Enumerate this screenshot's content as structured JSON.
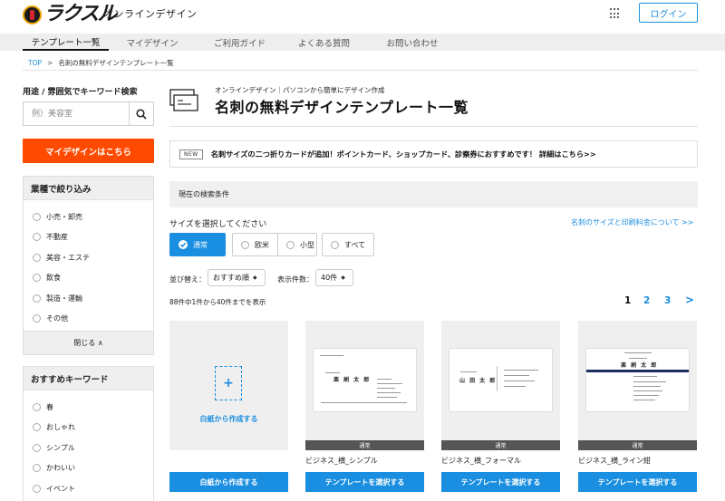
{
  "header": {
    "logo_text": "ラクスル",
    "site_title": "オンラインデザイン",
    "login_label": "ログイン"
  },
  "nav": [
    {
      "label": "テンプレート一覧",
      "active": true
    },
    {
      "label": "マイデザイン"
    },
    {
      "label": "ご利用ガイド"
    },
    {
      "label": "よくある質問"
    },
    {
      "label": "お問い合わせ"
    }
  ],
  "breadcrumb": {
    "home": "TOP",
    "separator": ">",
    "current": "名刺の無料デザインテンプレート一覧"
  },
  "sidebar": {
    "keyword_label": "用途 / 雰囲気でキーワード検索",
    "search_placeholder": "例）美容室",
    "mydesign_button": "マイデザインはこちら",
    "industry": {
      "title": "業種で絞り込み",
      "items": [
        "小売・卸売",
        "不動産",
        "美容・エステ",
        "飲食",
        "製造・運輸",
        "その他"
      ],
      "close_label": "閉じる ∧"
    },
    "keywords": {
      "title": "おすすめキーワード",
      "items": [
        "春",
        "おしゃれ",
        "シンプル",
        "かわいい",
        "イベント"
      ]
    }
  },
  "main": {
    "subtitle": "オンラインデザイン｜パソコンから簡単にデザイン作成",
    "title": "名刺の無料デザインテンプレート一覧",
    "news_badge": "NEW",
    "news_text": "名刺サイズの二つ折りカードが追加！ポイントカード、ショップカード、診察券におすすめです！ 詳細はこちら>>",
    "conditions_label": "現在の検索条件",
    "size_label": "サイズを選択してください",
    "size_link": "名刺のサイズと印刷料金について >>",
    "size_options": [
      {
        "label": "通常",
        "selected": true
      },
      {
        "label": "欧米"
      },
      {
        "label": "小型"
      },
      {
        "label": "すべて"
      }
    ],
    "sort_label": "並び替え：",
    "sort_value": "おすすめ順",
    "per_page_label": "表示件数：",
    "per_page_value": "40件",
    "count_text": "88件中1件から40件までを表示",
    "pages": [
      "1",
      "2",
      "3"
    ],
    "next_symbol": ">"
  },
  "cards": {
    "blank": {
      "label": "白紙から作成する",
      "button": "白紙から作成する"
    },
    "templates": [
      {
        "name": "ビジネス_横_シンプル",
        "badge": "通常",
        "button": "テンプレートを選択する",
        "person": "楽 刷 太 郎",
        "company": "ラクスル株式会社"
      },
      {
        "name": "ビジネス_横_フォーマル",
        "badge": "通常",
        "button": "テンプレートを選択する",
        "person": "山 田 太 郎"
      },
      {
        "name": "ビジネス_横_ライン紺",
        "badge": "通常",
        "button": "テンプレートを選択する",
        "person": "楽 刷 太 郎",
        "company": "ラクスル株式会社",
        "accent": "#1d2f5e"
      }
    ]
  },
  "colors": {
    "accent": "#1a8ee0",
    "cta": "#ff4a00"
  }
}
